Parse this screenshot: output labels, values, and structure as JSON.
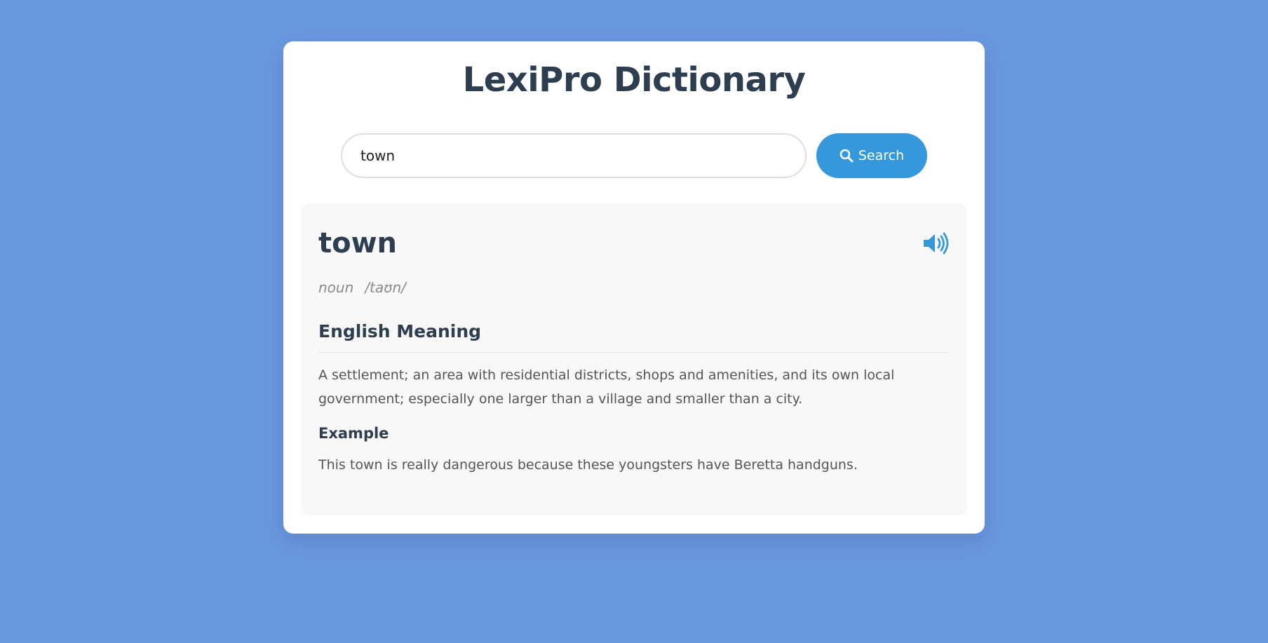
{
  "app": {
    "title": "LexiPro Dictionary"
  },
  "search": {
    "value": "town",
    "button_label": "Search",
    "button_icon": "search-icon"
  },
  "entry": {
    "word": "town",
    "part_of_speech": "noun",
    "phonetic": "/taʊn/",
    "audio_icon": "speaker-icon",
    "meaning_heading": "English Meaning",
    "definition": "A settlement; an area with residential districts, shops and amenities, and its own local government; especially one larger than a village and smaller than a city.",
    "example_heading": "Example",
    "example": "This town is really dangerous because these youngsters have Beretta handguns."
  },
  "colors": {
    "background": "#6a98df",
    "accent": "#3498db",
    "heading": "#2c3e50",
    "muted": "#8a8a8a"
  }
}
